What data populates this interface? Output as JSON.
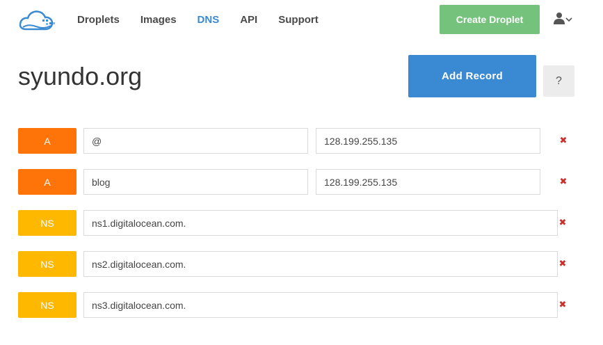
{
  "brand": {
    "logo_icon": "digitalocean-cloud-logo-icon",
    "color": "#3a8ad3"
  },
  "nav": {
    "items": [
      {
        "label": "Droplets",
        "active": false
      },
      {
        "label": "Images",
        "active": false
      },
      {
        "label": "DNS",
        "active": true
      },
      {
        "label": "API",
        "active": false
      },
      {
        "label": "Support",
        "active": false
      }
    ]
  },
  "header": {
    "create_button_label": "Create Droplet",
    "create_button_color": "#74c27b",
    "user_icon": "user-icon",
    "user_caret_icon": "chevron-down-icon"
  },
  "domain": {
    "title": "syundo.org",
    "add_record_label": "Add Record",
    "add_record_color": "#3a8ad3",
    "help_label": "?"
  },
  "record_colors": {
    "A": "#ff7409",
    "NS": "#ffb800",
    "remove": "#c9302c"
  },
  "records": [
    {
      "type": "A",
      "name": "@",
      "value": "128.199.255.135"
    },
    {
      "type": "A",
      "name": "blog",
      "value": "128.199.255.135"
    },
    {
      "type": "NS",
      "value": "ns1.digitalocean.com."
    },
    {
      "type": "NS",
      "value": "ns2.digitalocean.com."
    },
    {
      "type": "NS",
      "value": "ns3.digitalocean.com."
    }
  ],
  "remove_glyph": "✖"
}
